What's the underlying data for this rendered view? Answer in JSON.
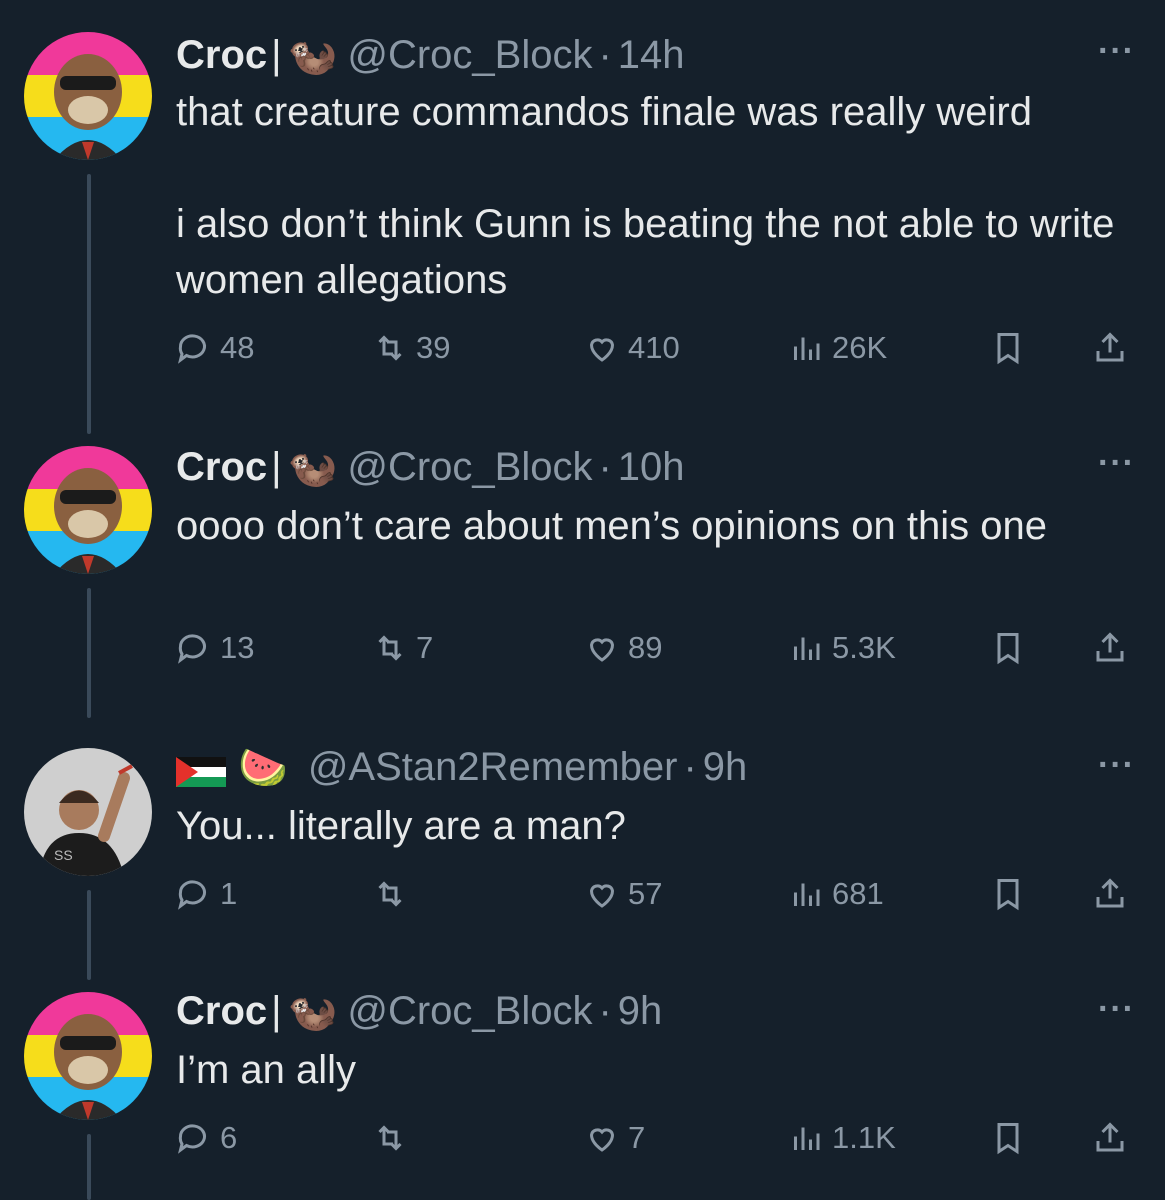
{
  "tweets": [
    {
      "name": "Croc",
      "separator": "|",
      "emoji": "🦦",
      "handle": "@Croc_Block",
      "time": "14h",
      "text": "that creature commandos finale was really weird\n\ni also don’t think Gunn is beating the not able to write women allegations",
      "replies": "48",
      "reposts": "39",
      "likes": "410",
      "views": "26K"
    },
    {
      "name": "Croc",
      "separator": "|",
      "emoji": "🦦",
      "handle": "@Croc_Block",
      "time": "10h",
      "text": "oooo don’t care about men’s opinions on this one",
      "replies": "13",
      "reposts": "7",
      "likes": "89",
      "views": "5.3K"
    },
    {
      "emoji": "🍉",
      "handle": "@AStan2Remember",
      "time": "9h",
      "text": "You... literally are a man?",
      "replies": "1",
      "reposts": "",
      "likes": "57",
      "views": "681"
    },
    {
      "name": "Croc",
      "separator": "|",
      "emoji": "🦦",
      "handle": "@Croc_Block",
      "time": "9h",
      "text": "I’m an ally",
      "replies": "6",
      "reposts": "",
      "likes": "7",
      "views": "1.1K"
    }
  ],
  "icons": {
    "reply": "reply-icon",
    "repost": "repost-icon",
    "like": "like-icon",
    "views": "views-icon",
    "bookmark": "bookmark-icon",
    "share": "share-icon",
    "more": "more-icon"
  },
  "colors": {
    "background": "#15202b",
    "text": "#e7e9ea",
    "secondary": "#8b98a5"
  }
}
